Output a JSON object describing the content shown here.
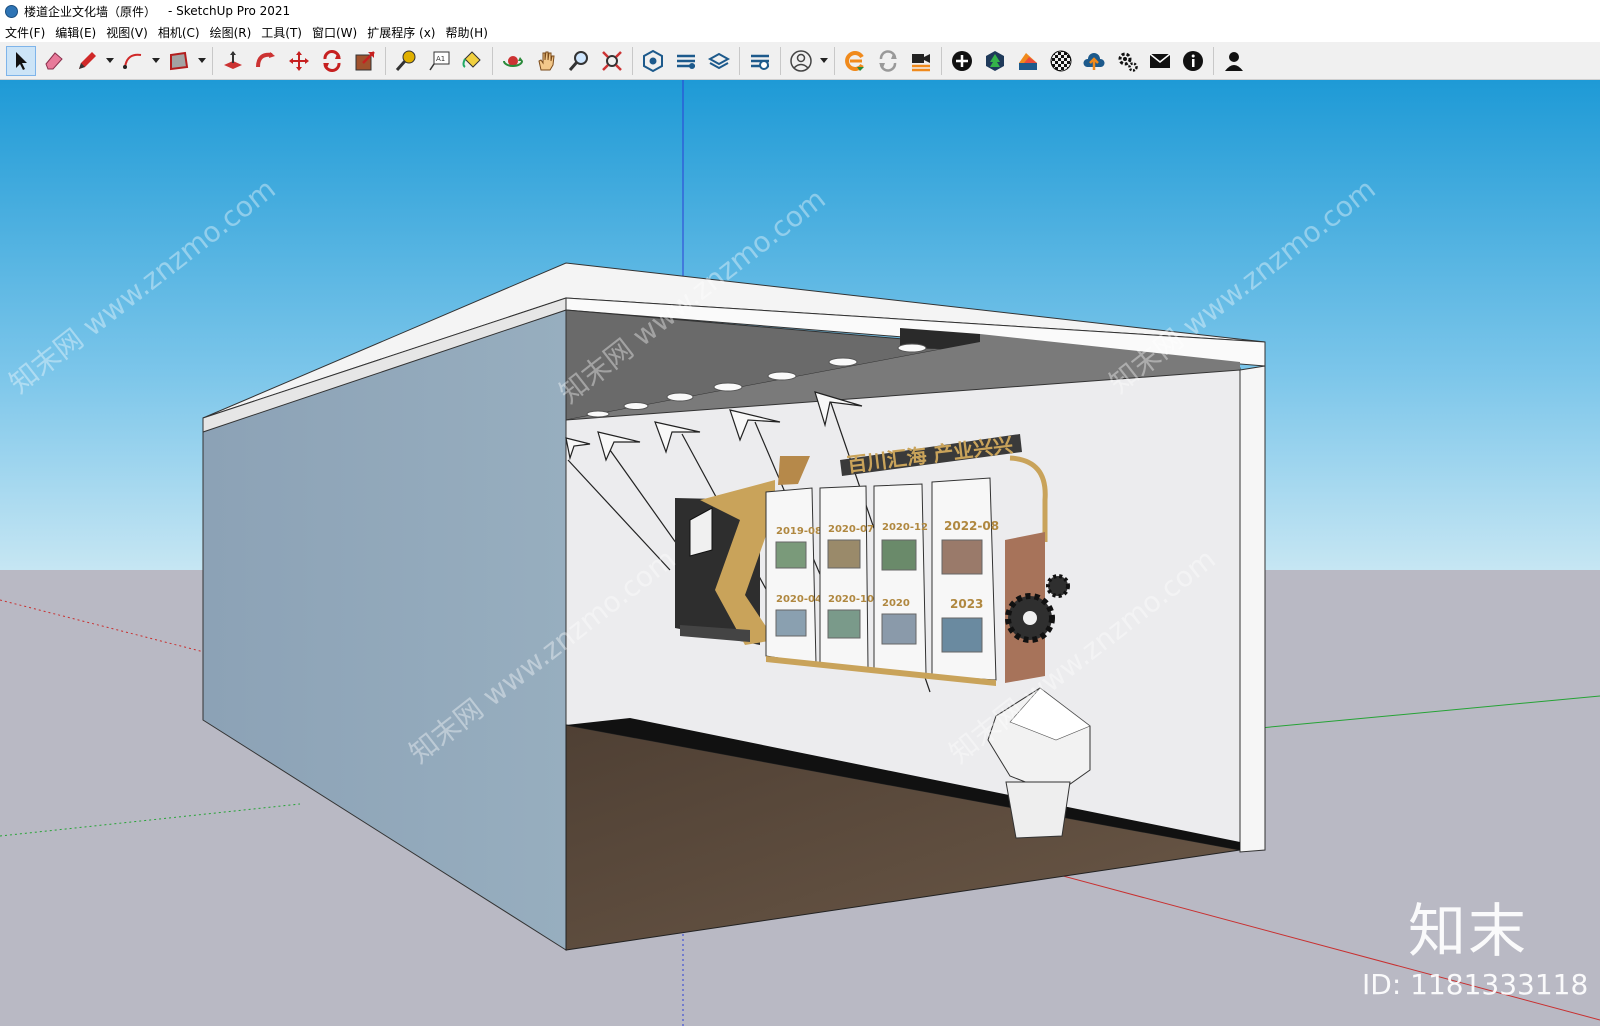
{
  "window": {
    "title": "楼道企业文化墙（原件）",
    "app": "- SketchUp Pro 2021"
  },
  "menu": [
    "文件(F)",
    "编辑(E)",
    "视图(V)",
    "相机(C)",
    "绘图(R)",
    "工具(T)",
    "窗口(W)",
    "扩展程序 (x)",
    "帮助(H)"
  ],
  "toolbar": {
    "tools": [
      "select-icon",
      "eraser-icon",
      "pencil-icon",
      "arc-icon",
      "rectangle-icon",
      "push-pull-icon",
      "follow-me-icon",
      "move-icon",
      "rotate-icon",
      "scale-icon",
      "tape-measure-icon",
      "text-icon",
      "paint-bucket-icon",
      "orbit-icon",
      "pan-icon",
      "zoom-icon",
      "zoom-extents-icon",
      "3d-warehouse-icon",
      "extension-warehouse-icon",
      "layout-icon",
      "extension-manager-icon",
      "user-icon",
      "render-icon",
      "sync-icon",
      "camera-icon",
      "add-icon",
      "tree-icon",
      "materials-icon",
      "checker-icon",
      "cloud-upload-icon",
      "settings-icon",
      "mail-icon",
      "info-icon",
      "account-icon"
    ],
    "text_tool_label": "A1"
  },
  "scene": {
    "wall_heading": "百川汇海 产业兴兴",
    "panels": [
      {
        "top_year": "2019-08",
        "bottom_year": "2020-04"
      },
      {
        "top_year": "2020-07",
        "bottom_year": "2020-10"
      },
      {
        "top_year": "2020-12",
        "bottom_year": "2020"
      },
      {
        "top_year": "2022-08",
        "bottom_year": "2023"
      }
    ]
  },
  "watermark": {
    "brand": "知末",
    "id_text": "ID: 1181333118",
    "diagonal": "知末网 www.znzmo.com"
  },
  "colors": {
    "sky_top": "#1e9ad6",
    "sky_bottom": "#bfe3f2",
    "ground": "#b9b9c4",
    "floor": "#5a4a3c",
    "wall_side": "#8fa6ba",
    "wall_back": "#e8e8ea",
    "ceiling": "#6d6d6d",
    "gold": "#c9a35a"
  }
}
